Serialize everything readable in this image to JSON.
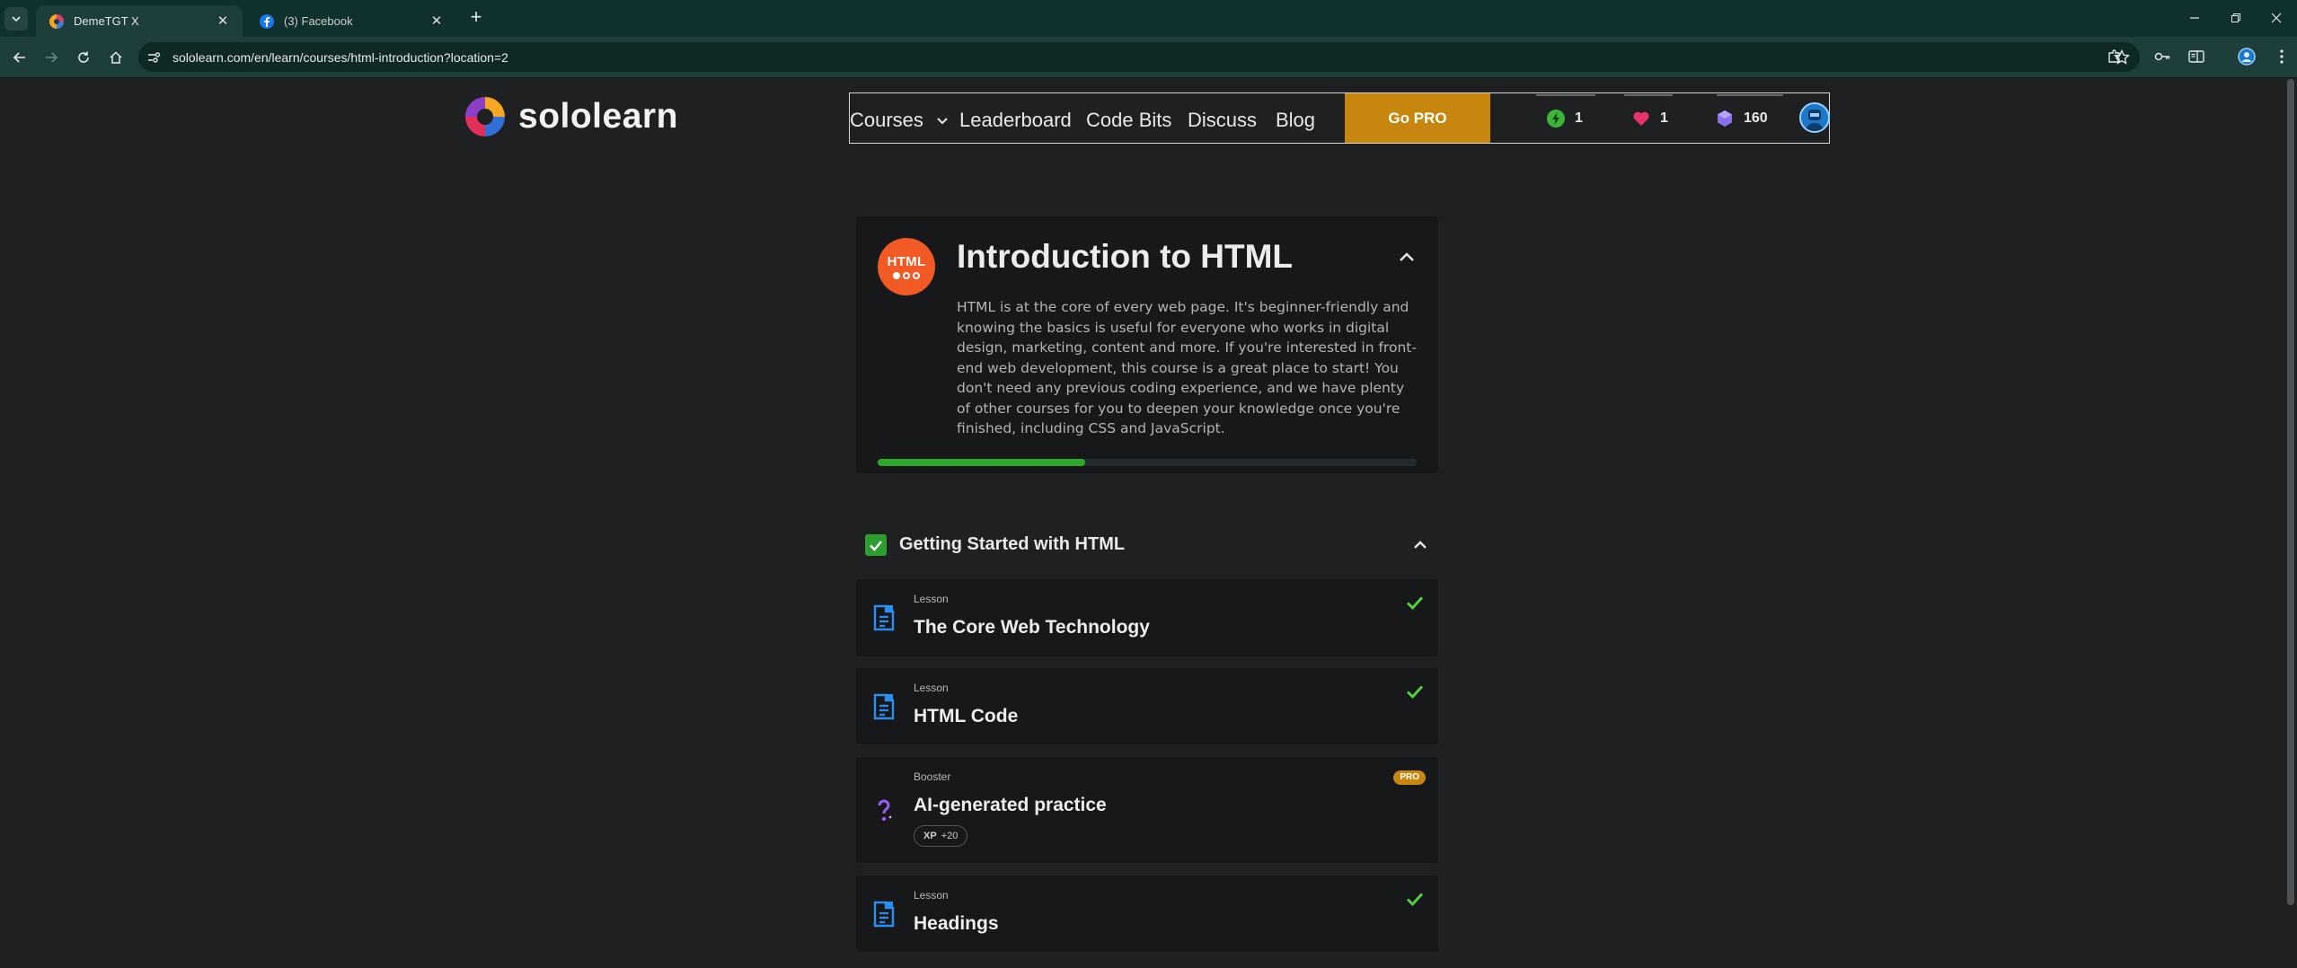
{
  "browser": {
    "tabs": [
      {
        "title": "DemeTGT X",
        "active": true
      },
      {
        "title": "(3) Facebook",
        "active": false
      }
    ],
    "new_tab_label": "+",
    "address": "sololearn.com/en/learn/courses/html-introduction?location=2"
  },
  "header": {
    "logo_text": "sololearn",
    "nav": [
      "Courses",
      "Leaderboard",
      "Code Bits",
      "Discuss",
      "Blog"
    ],
    "go_pro": "Go PRO",
    "stats": {
      "streak": "1",
      "hearts": "1",
      "gems": "160"
    },
    "colors": {
      "go_pro": "#c7870f",
      "streak": "#3db53a",
      "hearts": "#e8336d",
      "gems": "#8a6fe8"
    }
  },
  "course": {
    "badge": "HTML",
    "title": "Introduction to HTML",
    "description": "HTML is at the core of every web page. It's beginner-friendly and knowing the basics is useful for everyone who works in digital design, marketing, content and more. If you're interested in front-end web development, this course is a great place to start! You don't need any previous coding experience, and we have plenty of other courses for you to deepen your knowledge once you're finished, including CSS and JavaScript.",
    "progress_fraction": 0.385
  },
  "module": {
    "title": "Getting Started with HTML",
    "items": [
      {
        "kind": "Lesson",
        "name": "The Core Web Technology",
        "completed": true
      },
      {
        "kind": "Lesson",
        "name": "HTML Code",
        "completed": true
      },
      {
        "kind": "Booster",
        "name": "AI-generated practice",
        "pro_label": "PRO",
        "xp_label": "XP",
        "xp_value": "+20"
      },
      {
        "kind": "Lesson",
        "name": "Headings",
        "completed": true
      }
    ]
  }
}
